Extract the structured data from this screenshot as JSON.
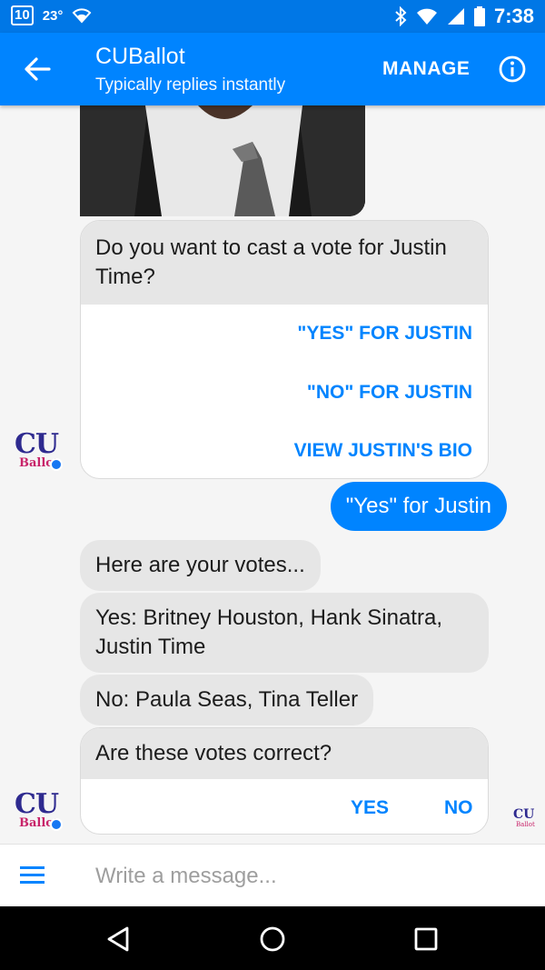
{
  "status_bar": {
    "notification_count": "10",
    "temperature": "23°",
    "time": "7:38"
  },
  "header": {
    "title": "CUBallot",
    "subtitle": "Typically replies instantly",
    "manage_label": "MANAGE"
  },
  "avatar": {
    "logo_text": "CU",
    "logo_sub": "Ballot"
  },
  "messages": {
    "vote_card": {
      "question": "Do you want to cast a vote for Justin Time?",
      "buttons": [
        "\"YES\" FOR JUSTIN",
        "\"NO\" FOR JUSTIN",
        "VIEW JUSTIN'S BIO"
      ]
    },
    "outgoing": "\"Yes\" for Justin",
    "votes_intro": "Here are your votes...",
    "yes_votes": "Yes: Britney Houston, Hank Sinatra, Justin Time",
    "no_votes": "No: Paula Seas, Tina Teller",
    "confirm_card": {
      "question": "Are these votes correct?",
      "yes_label": "YES",
      "no_label": "NO"
    }
  },
  "composer": {
    "placeholder": "Write a message..."
  },
  "colors": {
    "brand": "#0084ff",
    "status_bar": "#0077e6",
    "bubble_in": "#e6e6e6"
  }
}
